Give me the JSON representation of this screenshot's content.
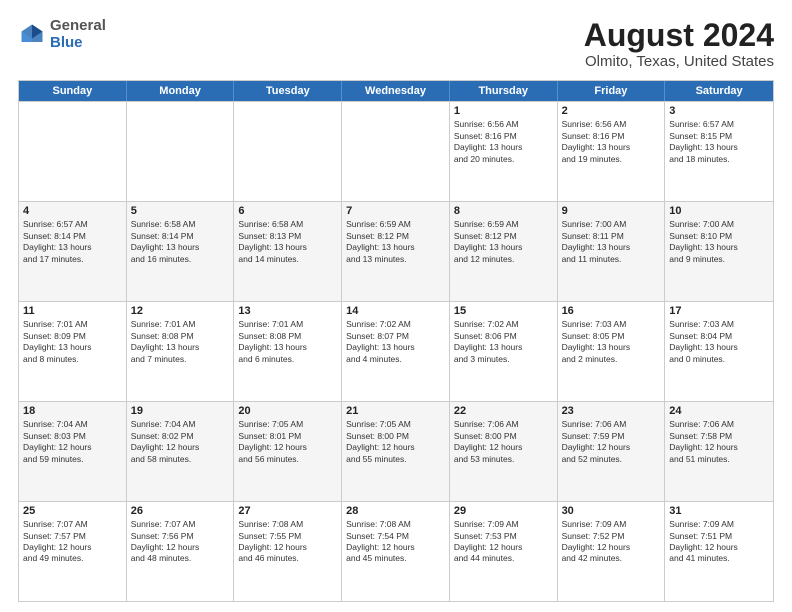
{
  "header": {
    "logo": {
      "general": "General",
      "blue": "Blue"
    },
    "title": "August 2024",
    "subtitle": "Olmito, Texas, United States"
  },
  "calendar": {
    "days_of_week": [
      "Sunday",
      "Monday",
      "Tuesday",
      "Wednesday",
      "Thursday",
      "Friday",
      "Saturday"
    ],
    "rows": [
      [
        {
          "day": "",
          "empty": true
        },
        {
          "day": "",
          "empty": true
        },
        {
          "day": "",
          "empty": true
        },
        {
          "day": "",
          "empty": true
        },
        {
          "day": "1",
          "info": "Sunrise: 6:56 AM\nSunset: 8:16 PM\nDaylight: 13 hours\nand 20 minutes."
        },
        {
          "day": "2",
          "info": "Sunrise: 6:56 AM\nSunset: 8:16 PM\nDaylight: 13 hours\nand 19 minutes."
        },
        {
          "day": "3",
          "info": "Sunrise: 6:57 AM\nSunset: 8:15 PM\nDaylight: 13 hours\nand 18 minutes."
        }
      ],
      [
        {
          "day": "4",
          "info": "Sunrise: 6:57 AM\nSunset: 8:14 PM\nDaylight: 13 hours\nand 17 minutes."
        },
        {
          "day": "5",
          "info": "Sunrise: 6:58 AM\nSunset: 8:14 PM\nDaylight: 13 hours\nand 16 minutes."
        },
        {
          "day": "6",
          "info": "Sunrise: 6:58 AM\nSunset: 8:13 PM\nDaylight: 13 hours\nand 14 minutes."
        },
        {
          "day": "7",
          "info": "Sunrise: 6:59 AM\nSunset: 8:12 PM\nDaylight: 13 hours\nand 13 minutes."
        },
        {
          "day": "8",
          "info": "Sunrise: 6:59 AM\nSunset: 8:12 PM\nDaylight: 13 hours\nand 12 minutes."
        },
        {
          "day": "9",
          "info": "Sunrise: 7:00 AM\nSunset: 8:11 PM\nDaylight: 13 hours\nand 11 minutes."
        },
        {
          "day": "10",
          "info": "Sunrise: 7:00 AM\nSunset: 8:10 PM\nDaylight: 13 hours\nand 9 minutes."
        }
      ],
      [
        {
          "day": "11",
          "info": "Sunrise: 7:01 AM\nSunset: 8:09 PM\nDaylight: 13 hours\nand 8 minutes."
        },
        {
          "day": "12",
          "info": "Sunrise: 7:01 AM\nSunset: 8:08 PM\nDaylight: 13 hours\nand 7 minutes."
        },
        {
          "day": "13",
          "info": "Sunrise: 7:01 AM\nSunset: 8:08 PM\nDaylight: 13 hours\nand 6 minutes."
        },
        {
          "day": "14",
          "info": "Sunrise: 7:02 AM\nSunset: 8:07 PM\nDaylight: 13 hours\nand 4 minutes."
        },
        {
          "day": "15",
          "info": "Sunrise: 7:02 AM\nSunset: 8:06 PM\nDaylight: 13 hours\nand 3 minutes."
        },
        {
          "day": "16",
          "info": "Sunrise: 7:03 AM\nSunset: 8:05 PM\nDaylight: 13 hours\nand 2 minutes."
        },
        {
          "day": "17",
          "info": "Sunrise: 7:03 AM\nSunset: 8:04 PM\nDaylight: 13 hours\nand 0 minutes."
        }
      ],
      [
        {
          "day": "18",
          "info": "Sunrise: 7:04 AM\nSunset: 8:03 PM\nDaylight: 12 hours\nand 59 minutes."
        },
        {
          "day": "19",
          "info": "Sunrise: 7:04 AM\nSunset: 8:02 PM\nDaylight: 12 hours\nand 58 minutes."
        },
        {
          "day": "20",
          "info": "Sunrise: 7:05 AM\nSunset: 8:01 PM\nDaylight: 12 hours\nand 56 minutes."
        },
        {
          "day": "21",
          "info": "Sunrise: 7:05 AM\nSunset: 8:00 PM\nDaylight: 12 hours\nand 55 minutes."
        },
        {
          "day": "22",
          "info": "Sunrise: 7:06 AM\nSunset: 8:00 PM\nDaylight: 12 hours\nand 53 minutes."
        },
        {
          "day": "23",
          "info": "Sunrise: 7:06 AM\nSunset: 7:59 PM\nDaylight: 12 hours\nand 52 minutes."
        },
        {
          "day": "24",
          "info": "Sunrise: 7:06 AM\nSunset: 7:58 PM\nDaylight: 12 hours\nand 51 minutes."
        }
      ],
      [
        {
          "day": "25",
          "info": "Sunrise: 7:07 AM\nSunset: 7:57 PM\nDaylight: 12 hours\nand 49 minutes."
        },
        {
          "day": "26",
          "info": "Sunrise: 7:07 AM\nSunset: 7:56 PM\nDaylight: 12 hours\nand 48 minutes."
        },
        {
          "day": "27",
          "info": "Sunrise: 7:08 AM\nSunset: 7:55 PM\nDaylight: 12 hours\nand 46 minutes."
        },
        {
          "day": "28",
          "info": "Sunrise: 7:08 AM\nSunset: 7:54 PM\nDaylight: 12 hours\nand 45 minutes."
        },
        {
          "day": "29",
          "info": "Sunrise: 7:09 AM\nSunset: 7:53 PM\nDaylight: 12 hours\nand 44 minutes."
        },
        {
          "day": "30",
          "info": "Sunrise: 7:09 AM\nSunset: 7:52 PM\nDaylight: 12 hours\nand 42 minutes."
        },
        {
          "day": "31",
          "info": "Sunrise: 7:09 AM\nSunset: 7:51 PM\nDaylight: 12 hours\nand 41 minutes."
        }
      ]
    ]
  }
}
